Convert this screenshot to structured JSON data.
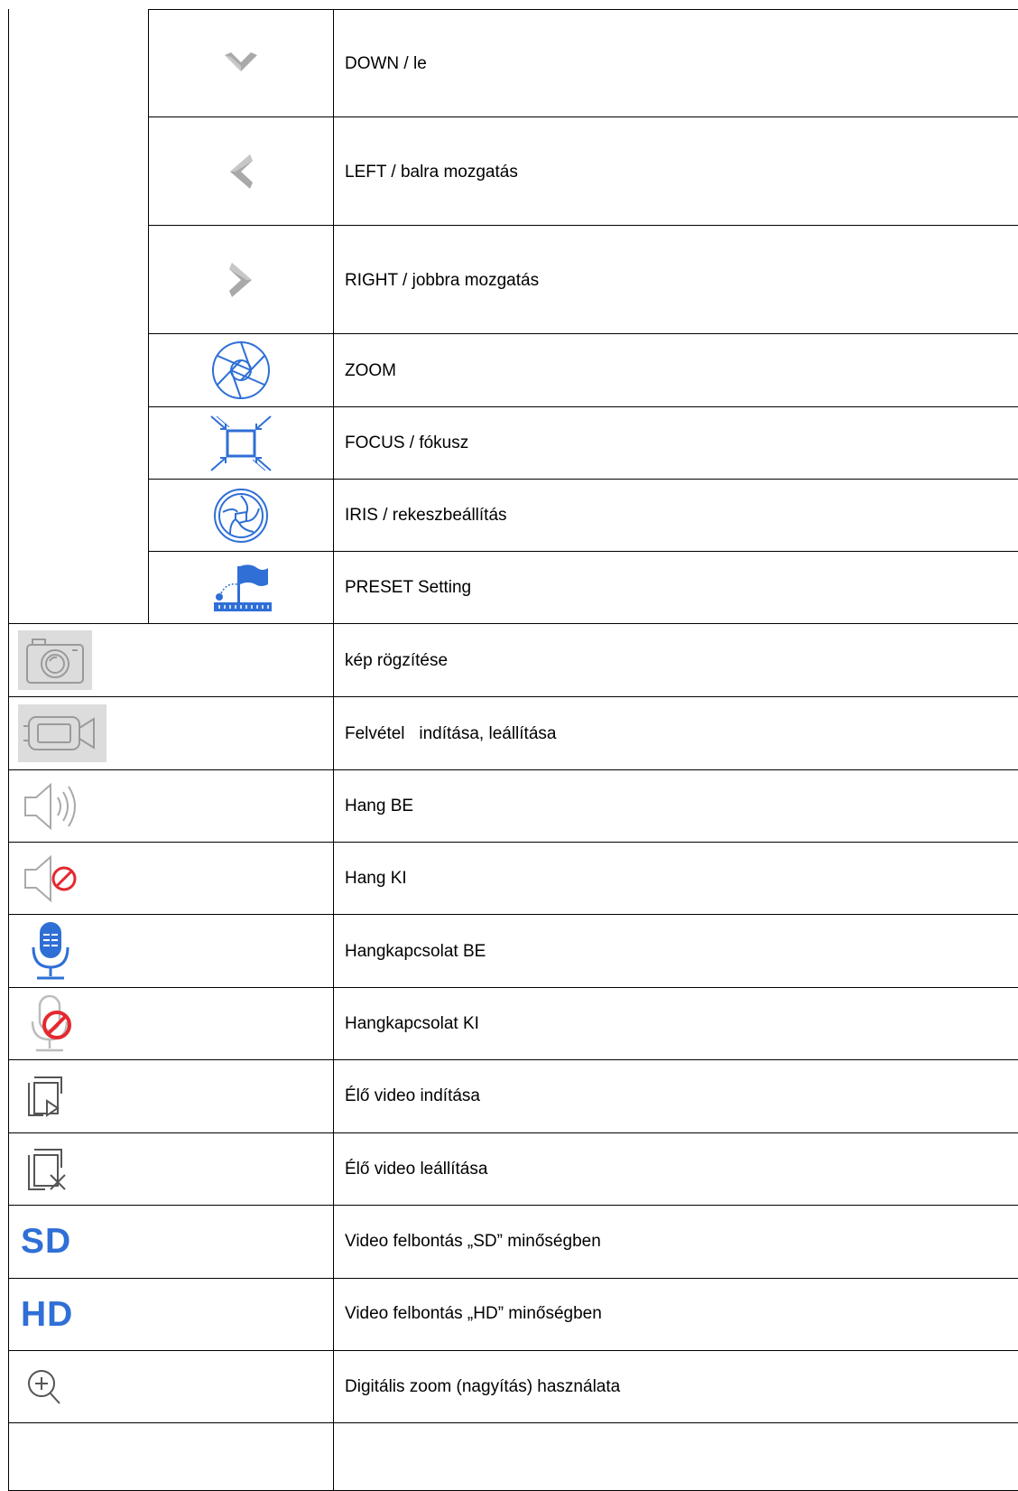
{
  "colors": {
    "icon_blue": "#2f6fd6",
    "icon_gray": "#a9a9a9",
    "icon_red": "#e5282f",
    "camera_bg": "#dcdcdc"
  },
  "rows": [
    {
      "icon": "chevron-down-icon",
      "label": "DOWN / le"
    },
    {
      "icon": "chevron-left-icon",
      "label": "LEFT / balra mozgatás"
    },
    {
      "icon": "chevron-right-icon",
      "label": "RIGHT / jobbra mozgatás"
    },
    {
      "icon": "zoom-aperture-icon",
      "label": "ZOOM"
    },
    {
      "icon": "focus-icon",
      "label": "FOCUS / fókusz"
    },
    {
      "icon": "iris-icon",
      "label": "IRIS / rekeszbeállítás"
    },
    {
      "icon": "preset-flag-icon",
      "label": "PRESET Setting"
    },
    {
      "icon": "camera-icon",
      "label": "kép rögzítése"
    },
    {
      "icon": "video-camera-icon",
      "label": "Felvétel   indítása, leállítása"
    },
    {
      "icon": "speaker-on-icon",
      "label": "Hang BE"
    },
    {
      "icon": "speaker-off-icon",
      "label": "Hang KI"
    },
    {
      "icon": "microphone-on-icon",
      "label": "Hangkapcsolat BE"
    },
    {
      "icon": "microphone-off-icon",
      "label": "Hangkapcsolat KI"
    },
    {
      "icon": "live-video-start-icon",
      "label": "Élő video indítása"
    },
    {
      "icon": "live-video-stop-icon",
      "label": "Élő video leállítása"
    },
    {
      "icon": "sd-icon",
      "icon_text": "SD",
      "label": "Video felbontás „SD” minőségben"
    },
    {
      "icon": "hd-icon",
      "icon_text": "HD",
      "label": "Video felbontás „HD” minőségben"
    },
    {
      "icon": "zoom-in-icon",
      "label": "Digitális zoom (nagyítás) használata"
    }
  ]
}
